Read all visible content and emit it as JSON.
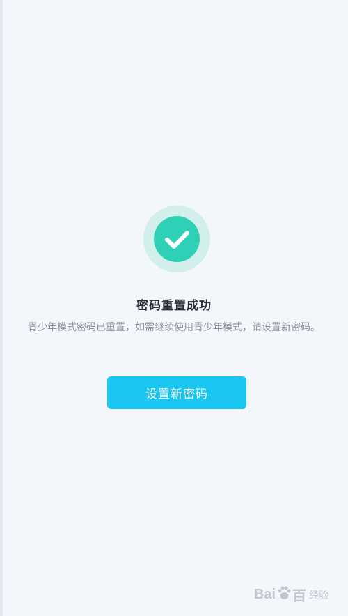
{
  "result": {
    "title": "密码重置成功",
    "message": "青少年模式密码已重置，如需继续使用青少年模式，请设置新密码。",
    "status_icon": "check-circle-icon",
    "colors": {
      "success": "#2fd1b6",
      "success_halo": "#d3efeb",
      "primary": "#19c6f0"
    }
  },
  "actions": {
    "set_new_password_label": "设置新密码"
  },
  "watermark": {
    "brand_left": "Bai",
    "brand_right": "百",
    "sub": "经验",
    "icon": "baidu-paw-icon"
  }
}
